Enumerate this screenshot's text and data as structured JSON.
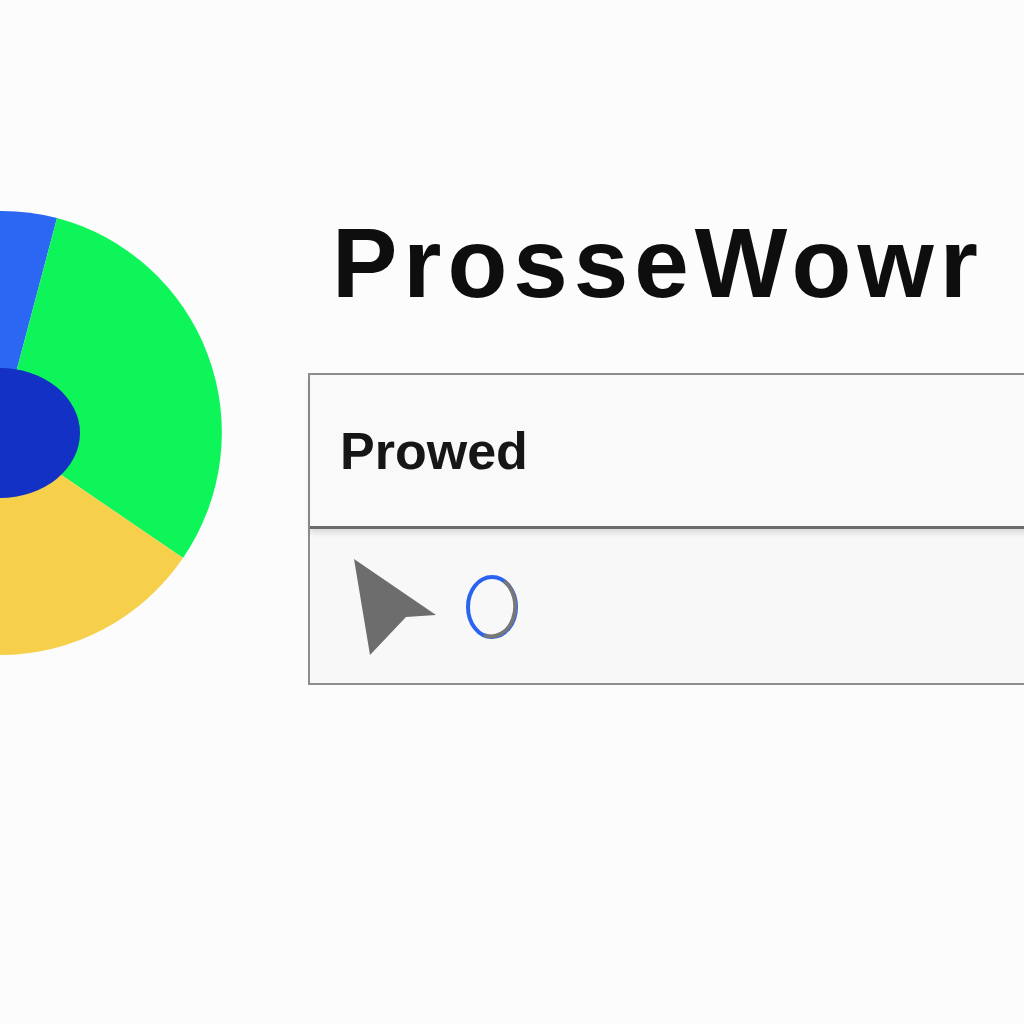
{
  "title": "ProsseWowr",
  "panel": {
    "field": {
      "value": "Prowed"
    }
  }
}
